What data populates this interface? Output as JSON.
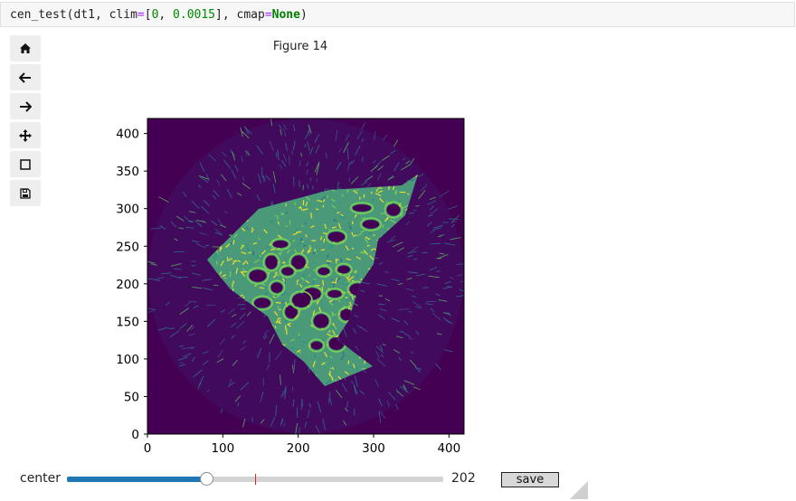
{
  "code": {
    "fn": "cen_test",
    "arg1": "dt1",
    "clim_kw": "clim",
    "clim_lo": "0",
    "clim_hi": "0.0015",
    "cmap_kw": "cmap",
    "cmap_val": "None"
  },
  "toolbar": {
    "items": [
      {
        "name": "home-icon"
      },
      {
        "name": "back-arrow-icon"
      },
      {
        "name": "forward-arrow-icon"
      },
      {
        "name": "pan-move-icon"
      },
      {
        "name": "zoom-rectangle-icon"
      },
      {
        "name": "save-figure-icon"
      }
    ]
  },
  "figure": {
    "title": "Figure 14",
    "background_color": "#440154",
    "accent_color": "#fde725"
  },
  "chart_data": {
    "type": "heatmap",
    "title": "",
    "xlabel": "",
    "ylabel": "",
    "xlim": [
      0,
      420
    ],
    "ylim": [
      0,
      420
    ],
    "xticks": [
      "0",
      "100",
      "200",
      "300",
      "400"
    ],
    "yticks": [
      "0",
      "50",
      "100",
      "150",
      "200",
      "250",
      "300",
      "350",
      "400"
    ],
    "colormap": "viridis",
    "clim": [
      0,
      0.0015
    ]
  },
  "widgets": {
    "slider_label": "center",
    "slider_value": "202",
    "slider_fraction": 0.37,
    "slider_color": "#1f77b4",
    "marker_color": "#d62728",
    "save_label": "save"
  }
}
